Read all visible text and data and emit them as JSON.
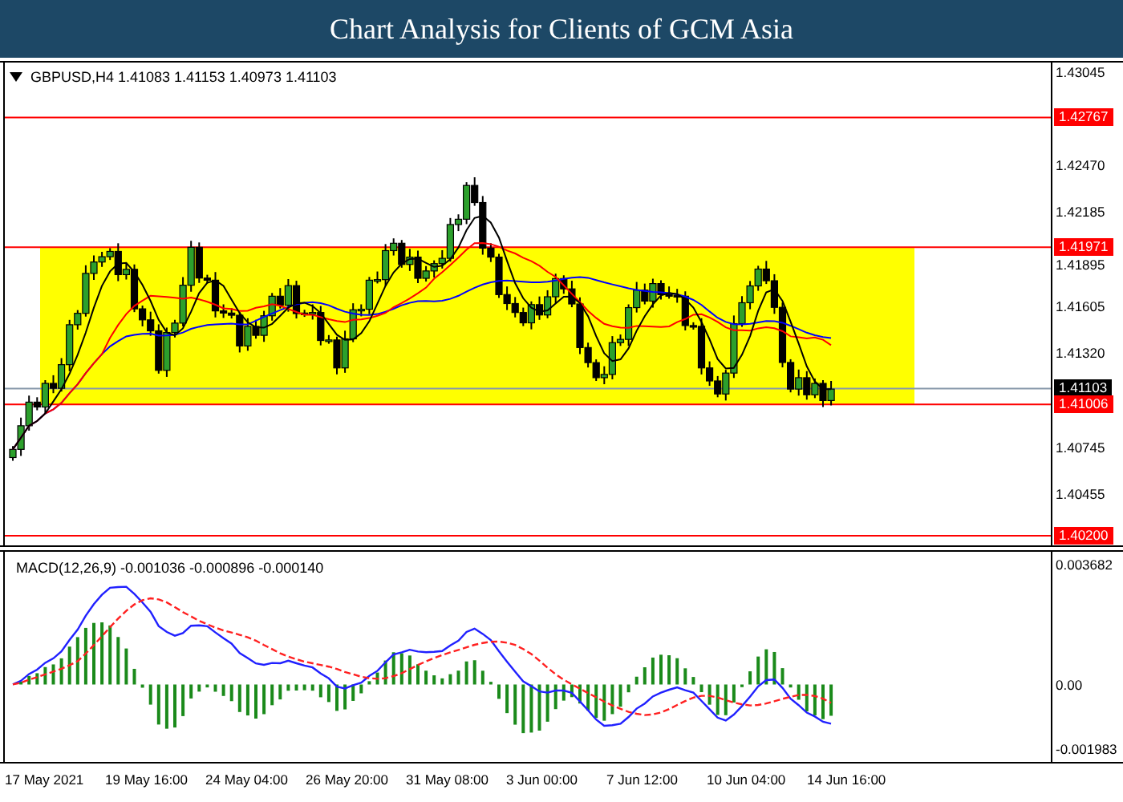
{
  "header": {
    "title": "Chart Analysis for Clients of GCM Asia"
  },
  "chart": {
    "info": "GBPUSD,H4  1.41083 1.41153 1.40973 1.41103",
    "price_ticks": [
      "1.43045",
      "1.42470",
      "1.42185",
      "1.41895",
      "1.41605",
      "1.41320",
      "1.40745",
      "1.40455"
    ],
    "levels": [
      {
        "label": "1.42767",
        "kind": "target"
      },
      {
        "label": "1.41971",
        "kind": "zone"
      },
      {
        "label": "1.41103",
        "kind": "bid"
      },
      {
        "label": "1.41006",
        "kind": "zone"
      },
      {
        "label": "1.40200",
        "kind": "target"
      }
    ]
  },
  "macd": {
    "info": "MACD(12,26,9) -0.001036 -0.000896 -0.000140",
    "axis": [
      "0.003682",
      "0.00",
      "-0.001983"
    ]
  },
  "time_axis": [
    "17 May 2021",
    "19 May 16:00",
    "24 May 04:00",
    "26 May 20:00",
    "31 May 08:00",
    "3 Jun 00:00",
    "7 Jun 12:00",
    "10 Jun 04:00",
    "14 Jun 16:00"
  ]
}
